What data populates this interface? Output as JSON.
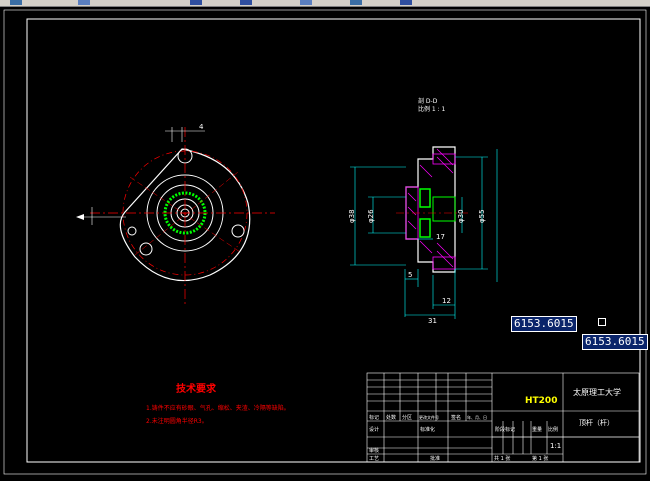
{
  "toolbar": {
    "icons": [
      "undo-icon",
      "redo-icon",
      "zoom-icon",
      "pan-icon",
      "layer-icon",
      "properties-icon",
      "match-icon"
    ]
  },
  "drawing": {
    "section_label": "剖 D-D",
    "scale_label": "比例 1 : 1",
    "dims": {
      "d38": "φ38",
      "d26": "φ26",
      "d30": "φ30",
      "d55": "φ55",
      "d12": "12",
      "d5": "5",
      "d17": "17",
      "d31": "31",
      "d4": "4"
    },
    "tech_title": "技术要求",
    "tech_items": [
      "1.铸件不应有砂眼、气孔、缩松、夹渣、冷隔等缺陷。",
      "2.未注明圆角半径R3。"
    ],
    "title_block": {
      "part_no": "HT200",
      "school": "太原理工大学",
      "part_name": "顶杆（杆）",
      "scale": "1:1",
      "row_labels": [
        "标记",
        "处数",
        "分区",
        "更改文件号",
        "签名",
        "年、月、日"
      ],
      "design": "设计",
      "standardization": "标准化",
      "review": "审核",
      "process": "工艺",
      "approve": "批准",
      "stage_mark": "阶段标记",
      "weight": "重量",
      "ratio": "比例",
      "sheets_total": "共 1 张",
      "sheet_no": "第 1 张"
    }
  },
  "coords": {
    "field1": "6153.6015",
    "field2": "6153.6015"
  },
  "colors": {
    "red": "#ff0000",
    "white": "#ffffff",
    "cyan": "#00ffff",
    "green": "#00ff00",
    "magenta": "#ff00ff"
  }
}
